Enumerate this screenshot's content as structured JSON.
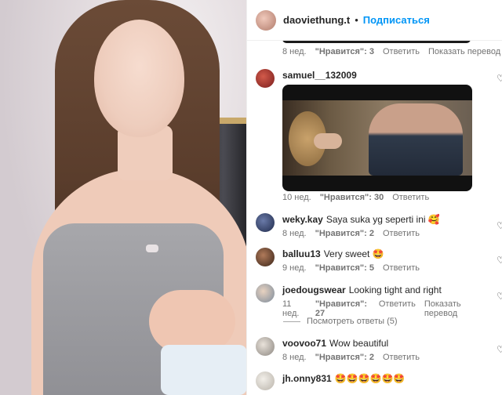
{
  "post": {
    "author": "daoviethung.t",
    "separator": "•",
    "follow_label": "Подписаться"
  },
  "first_meta": {
    "time": "8 нед.",
    "likes": "\"Нравится\": 3",
    "reply": "Ответить",
    "translate": "Показать перевод"
  },
  "comments": [
    {
      "user": "samuel__132009",
      "text": "",
      "time": "10 нед.",
      "likes": "\"Нравится\": 30",
      "reply": "Ответить",
      "has_video": true
    },
    {
      "user": "weky.kay",
      "text": "Saya suka yg seperti ini 🥰",
      "time": "8 нед.",
      "likes": "\"Нравится\": 2",
      "reply": "Ответить"
    },
    {
      "user": "balluu13",
      "text": "Very sweet 🤩",
      "time": "9 нед.",
      "likes": "\"Нравится\": 5",
      "reply": "Ответить"
    },
    {
      "user": "joedougswear",
      "text": "Looking tight and right",
      "time": "11 нед.",
      "likes": "\"Нравится\": 27",
      "reply": "Ответить",
      "translate": "Показать перевод"
    },
    {
      "user": "voovoo71",
      "text": "Wow beautiful",
      "time": "8 нед.",
      "likes": "\"Нравится\": 2",
      "reply": "Ответить"
    },
    {
      "user": "jh.onny831",
      "text": "🤩🤩🤩🤩🤩🤩",
      "time": "",
      "likes": "",
      "reply": ""
    }
  ],
  "view_replies": "Посмотреть ответы (5)",
  "colors": {
    "link": "#0095f6",
    "muted": "#737373",
    "text": "#262626"
  },
  "icons": {
    "like": "heart-outline-icon"
  }
}
